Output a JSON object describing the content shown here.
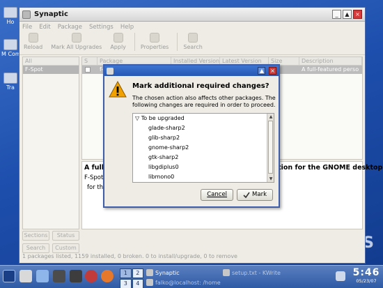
{
  "desktop": {
    "icons": [
      {
        "label": "Ho"
      },
      {
        "label": "M Comp"
      },
      {
        "label": "Tra"
      }
    ],
    "logo_text": "OS"
  },
  "window": {
    "title": "Synaptic",
    "menu": [
      "File",
      "Edit",
      "Package",
      "Settings",
      "Help"
    ],
    "toolbar": [
      {
        "label": "Reload",
        "icon": "reload-icon"
      },
      {
        "label": "Mark All Upgrades",
        "icon": "upgrade-icon"
      },
      {
        "label": "Apply",
        "icon": "apply-icon"
      },
      {
        "label": "Properties",
        "icon": "properties-icon"
      },
      {
        "label": "Search",
        "icon": "search-icon"
      }
    ],
    "filters": {
      "header": "All",
      "items": [
        "F-Spot"
      ]
    },
    "side_buttons": [
      {
        "label": "Sections"
      },
      {
        "label": "Status"
      },
      {
        "label": "Search"
      },
      {
        "label": "Custom"
      }
    ],
    "columns": [
      "S",
      "Package",
      "Installed Version",
      "Latest Version",
      "Size",
      "Description"
    ],
    "rows": [
      {
        "package": "f-spot",
        "description": "A full-featured perso"
      }
    ],
    "description_title": "A full-featured personal photo management application for the GNOME desktop",
    "description_line1": "F-Spot",
    "description_line2": "for the",
    "status": "1 packages listed, 1159 installed, 0 broken. 0 to install/upgrade, 0 to remove"
  },
  "dialog": {
    "heading": "Mark additional required changes?",
    "body": "The chosen action also affects other packages. The following changes are required in order to proceed.",
    "group": "To be upgraded",
    "items": [
      "glade-sharp2",
      "glib-sharp2",
      "gnome-sharp2",
      "gtk-sharp2",
      "libgdiplus0",
      "libmono0"
    ],
    "cancel_label": "Cancel",
    "mark_label": "Mark"
  },
  "taskbar": {
    "pager": [
      "1",
      "2",
      "3",
      "4"
    ],
    "tasks": [
      {
        "label": "Synaptic"
      },
      {
        "label": "setup.txt - KWrite"
      },
      {
        "label": "falko@localhost: /home"
      }
    ],
    "time": "5:46",
    "date": "05/23/07"
  },
  "colors": {
    "dialog_border": "#3d5da7",
    "desktop_bg": "#1e4fae",
    "warning": "#f1a100"
  }
}
